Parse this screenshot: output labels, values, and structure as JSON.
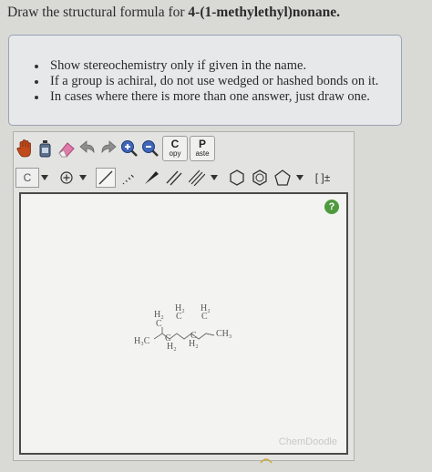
{
  "question": {
    "prefix": "Draw the structural formula for ",
    "compound": "4-(1-methylethyl)nonane."
  },
  "instructions": [
    "Show stereochemistry only if given in the name.",
    "If a group is achiral, do not use wedged or hashed bonds on it.",
    "In cases where there is more than one answer, just draw one."
  ],
  "toolbar": {
    "copy_top": "C",
    "copy_bottom": "opy",
    "paste_top": "P",
    "paste_bottom": "aste",
    "carbon_label": "C",
    "bracket_label": "[ ]±"
  },
  "canvas": {
    "help_label": "?",
    "brand": "ChemDoodle",
    "molecule_labels": {
      "h3c": "H₃C",
      "ch3": "CH₃",
      "h2_a": "H₂",
      "h2_b": "H₂",
      "h2_c": "H₂",
      "h2_d": "H₂",
      "h2_e": "H₂",
      "c_a": "C",
      "c_b": "C",
      "c_c": "C",
      "c_d": "C",
      "c_e": "C"
    }
  },
  "colors": {
    "accent_green": "#4f9a3e",
    "border_blue": "#9aa3b3"
  }
}
